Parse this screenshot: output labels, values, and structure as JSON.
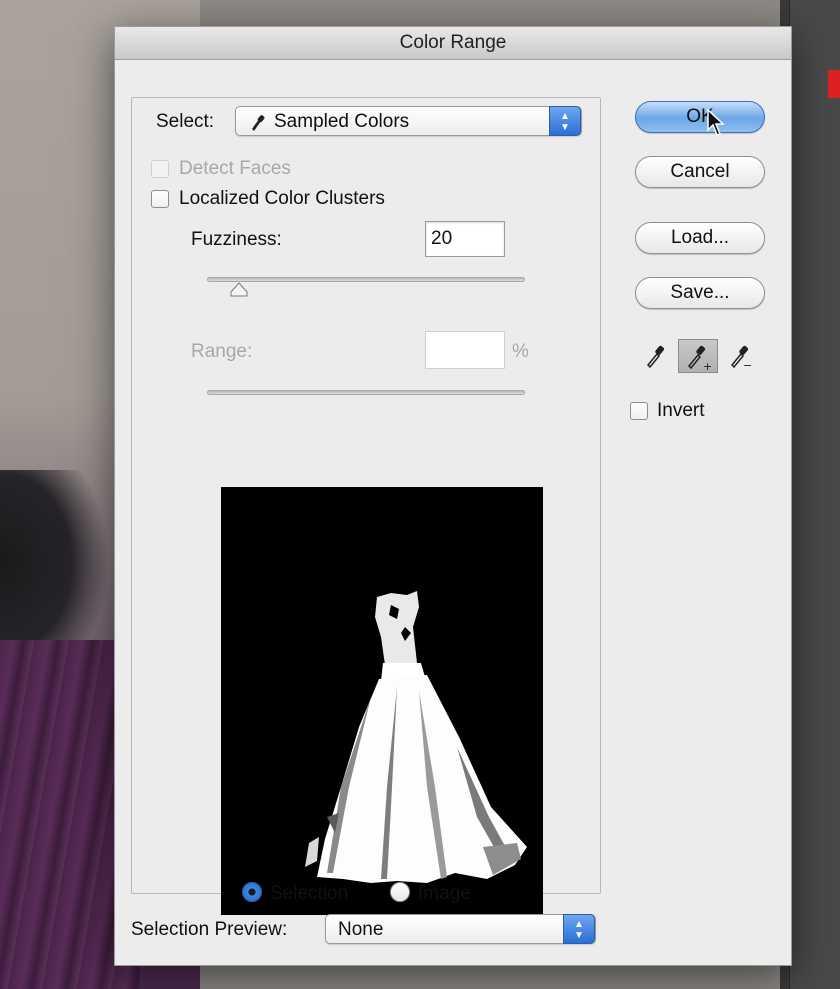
{
  "dialog": {
    "title": "Color Range",
    "select_label": "Select:",
    "select_value": "Sampled Colors",
    "detect_faces_label": "Detect Faces",
    "localized_clusters_label": "Localized Color Clusters",
    "fuzziness_label": "Fuzziness:",
    "fuzziness_value": "20",
    "fuzziness_level": 0.1,
    "range_label": "Range:",
    "range_value": "",
    "range_unit": "%",
    "preview_mode": {
      "selection_label": "Selection",
      "image_label": "Image",
      "selected": "selection"
    },
    "selection_preview_label": "Selection Preview:",
    "selection_preview_value": "None"
  },
  "buttons": {
    "ok": "OK",
    "cancel": "Cancel",
    "load": "Load...",
    "save": "Save..."
  },
  "eyedroppers": [
    {
      "icon": "eyedropper-icon",
      "active": false
    },
    {
      "icon": "eyedropper-add-icon",
      "active": true
    },
    {
      "icon": "eyedropper-subtract-icon",
      "active": false
    }
  ],
  "invert_label": "Invert",
  "colors": {
    "accent": "#3b86e8",
    "dialog_bg": "#ececec",
    "preview_bg": "#000000"
  }
}
